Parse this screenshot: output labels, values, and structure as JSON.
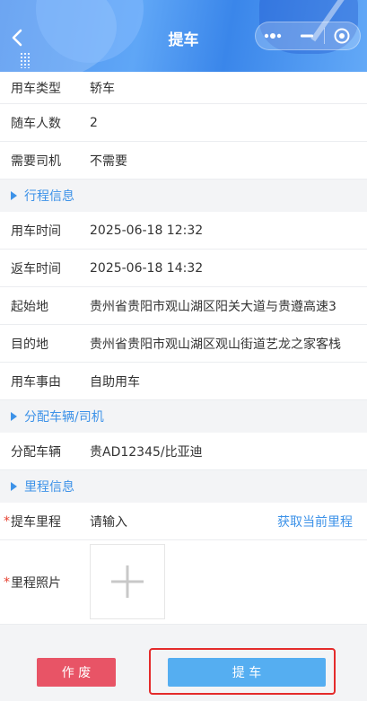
{
  "header": {
    "title": "提车",
    "back_icon": "chevron-left-icon",
    "capsule": {
      "more_icon": "more-dots-icon",
      "minimize_icon": "minimize-icon",
      "close_icon": "target-close-icon"
    }
  },
  "form": {
    "car_type": {
      "label": "用车类型",
      "value": "轿车"
    },
    "passengers": {
      "label": "随车人数",
      "value": "2"
    },
    "need_driver": {
      "label": "需要司机",
      "value": "不需要"
    },
    "trip_section": "行程信息",
    "use_time": {
      "label": "用车时间",
      "value": "2025-06-18 12:32"
    },
    "return_time": {
      "label": "返车时间",
      "value": "2025-06-18 14:32"
    },
    "origin": {
      "label": "起始地",
      "value": "贵州省贵阳市观山湖区阳关大道与贵遵高速3"
    },
    "destination": {
      "label": "目的地",
      "value": "贵州省贵阳市观山湖区观山街道艺龙之家客栈"
    },
    "reason": {
      "label": "用车事由",
      "value": "自助用车"
    },
    "assign_section": "分配车辆/司机",
    "vehicle": {
      "label": "分配车辆",
      "value": "贵AD12345/比亚迪"
    },
    "mileage_section": "里程信息",
    "pickup_mileage": {
      "required": "*",
      "label": "提车里程",
      "placeholder": "请输入",
      "action": "获取当前里程"
    },
    "mileage_photo": {
      "required": "*",
      "label": "里程照片",
      "upload_icon": "plus-icon"
    }
  },
  "footer": {
    "void_label": "作 废",
    "submit_label": "提 车"
  },
  "colors": {
    "accent": "#3d92e8",
    "void": "#e85466",
    "submit": "#55aef1",
    "highlight": "#e42b2b"
  }
}
